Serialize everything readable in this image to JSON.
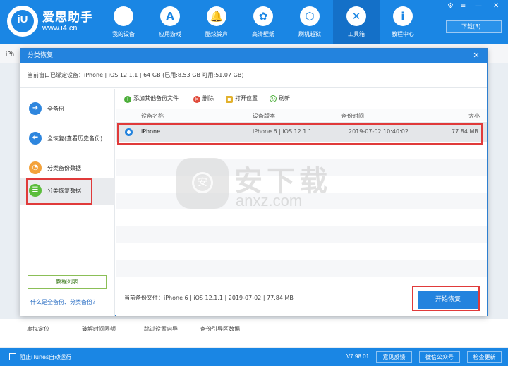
{
  "header": {
    "logo_text": "iU",
    "brand_name": "爱思助手",
    "brand_url": "www.i4.cn",
    "nav": [
      {
        "label": "我的设备",
        "glyph": ""
      },
      {
        "label": "应用游戏",
        "glyph": "A"
      },
      {
        "label": "酷炫铃声",
        "glyph": "🔔"
      },
      {
        "label": "高清壁纸",
        "glyph": "✿"
      },
      {
        "label": "刷机越狱",
        "glyph": "⬡"
      },
      {
        "label": "工具箱",
        "glyph": "✕"
      },
      {
        "label": "教程中心",
        "glyph": "i"
      }
    ],
    "download_label": "下载(3)...",
    "window_controls": [
      "⚙",
      "≡",
      "—",
      "✕"
    ]
  },
  "background": {
    "tab_label": "iPh",
    "bottom_tools": [
      "虚拟定位",
      "破解时间限额",
      "跳过设置向导",
      "备份引导区数据"
    ]
  },
  "dialog": {
    "title": "分类恢复",
    "close": "✕",
    "device_info": "当前窗口已绑定设备：iPhone  |  iOS 12.1.1  |  64 GB (已用:8.53 GB 可用:51.07 GB)",
    "sidebar": {
      "items": [
        {
          "label": "全备份",
          "color": "#2e86de",
          "glyph": "➜"
        },
        {
          "label": "全恢复(查看历史备份)",
          "color": "#2e86de",
          "glyph": "⬅"
        },
        {
          "label": "分类备份数据",
          "color": "#f3a23b",
          "glyph": "◔"
        },
        {
          "label": "分类恢复数据",
          "color": "#5bbd3b",
          "glyph": "☰"
        }
      ],
      "tutorial_label": "教程列表",
      "what_link": "什么是全备份、分类备份？"
    },
    "toolbar": {
      "add_label": "添加其他备份文件",
      "delete_label": "删除",
      "open_label": "打开位置",
      "refresh_label": "刷新"
    },
    "table": {
      "headers": [
        "设备名称",
        "设备版本",
        "备份时间",
        "大小"
      ],
      "rows": [
        {
          "name": "iPhone",
          "version": "iPhone 6 | iOS 12.1.1",
          "time": "2019-07-02 10:40:02",
          "size": "77.84 MB"
        }
      ]
    },
    "footer": {
      "current_backup": "当前备份文件：iPhone 6 | iOS 12.1.1 | 2019-07-02 | 77.84 MB",
      "start_label": "开始恢复"
    }
  },
  "watermark": {
    "glyph": "安",
    "title": "安下载",
    "sub": "anxz.com"
  },
  "statusbar": {
    "itunes_label": "阻止iTunes自动运行",
    "version": "V7.98.01",
    "feedback_label": "意见反馈",
    "wechat_label": "微信公众号",
    "update_label": "检查更新"
  }
}
